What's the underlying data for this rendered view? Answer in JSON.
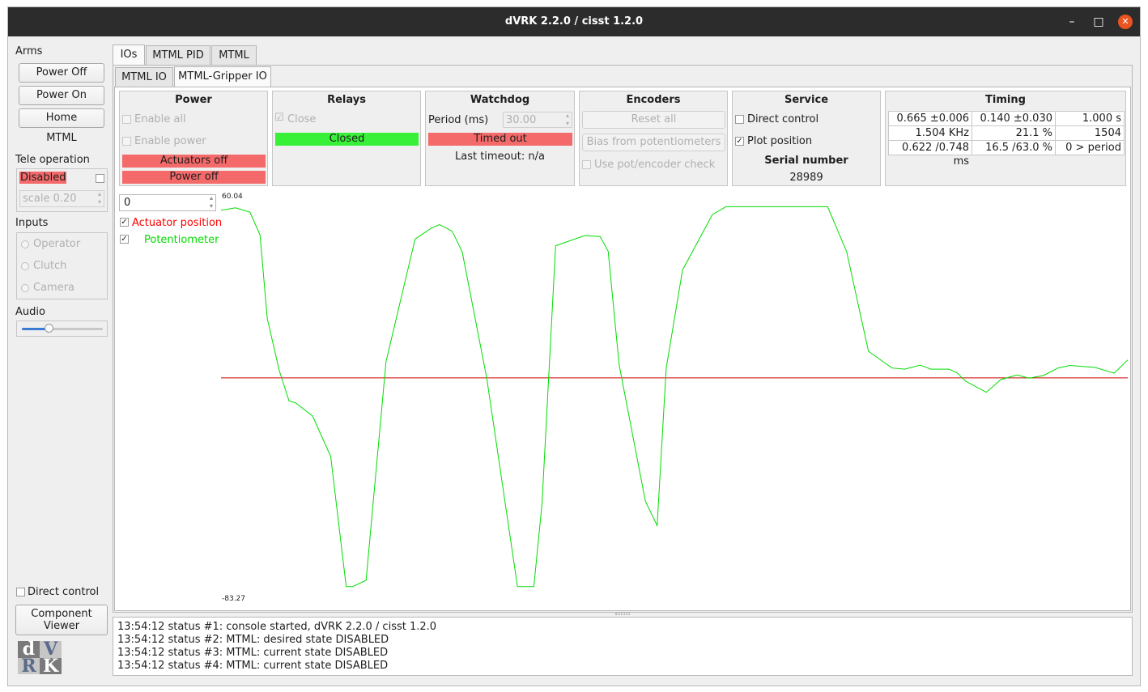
{
  "window": {
    "title": "dVRK 2.2.0 / cisst 1.2.0",
    "min_glyph": "–",
    "max_glyph": "□",
    "close_glyph": "✕"
  },
  "left": {
    "arms_label": "Arms",
    "power_off": "Power Off",
    "power_on": "Power On",
    "home": "Home",
    "arm_name": "MTML",
    "teleop_label": "Tele operation",
    "teleop_state": "Disabled",
    "scale": "scale 0.20",
    "inputs_label": "Inputs",
    "inputs": [
      "Operator",
      "Clutch",
      "Camera"
    ],
    "audio_label": "Audio",
    "audio_level": 0.33,
    "direct_control": "Direct control",
    "component_viewer_1": "Component",
    "component_viewer_2": "Viewer",
    "logo_letters": [
      "d",
      "V",
      "R",
      "K"
    ]
  },
  "tabs": {
    "top": [
      "IOs",
      "MTML PID",
      "MTML"
    ],
    "sub": [
      "MTML IO",
      "MTML-Gripper IO"
    ]
  },
  "power": {
    "title": "Power",
    "enable_all": "Enable all",
    "enable_power": "Enable power",
    "actuators": "Actuators off",
    "power_state": "Power off"
  },
  "relays": {
    "title": "Relays",
    "close": "Close",
    "state": "Closed",
    "close_check": "☑"
  },
  "watchdog": {
    "title": "Watchdog",
    "period_label": "Period (ms)",
    "period_value": "30.00",
    "state": "Timed out",
    "last_timeout": "Last timeout: n/a"
  },
  "encoders": {
    "title": "Encoders",
    "reset_all": "Reset all",
    "bias": "Bias from potentiometers",
    "use_pot": "Use pot/encoder check"
  },
  "service": {
    "title": "Service",
    "direct_control": "Direct control",
    "plot_position": "Plot position",
    "serial_label": "Serial number",
    "serial_value": "28989",
    "check": "✓"
  },
  "timing": {
    "title": "Timing",
    "rows": [
      [
        "0.665 ±0.006 ms",
        "0.140 ±0.030 ms",
        "1.000 s"
      ],
      [
        "1.504  KHz",
        "21.1 %",
        "1504 samples"
      ],
      [
        "0.622 /0.748 ms",
        "16.5 /63.0 %",
        "0 > period"
      ]
    ]
  },
  "plot": {
    "index_value": "0",
    "legend": [
      {
        "label": "Actuator position",
        "color": "#ff0000",
        "check": "✓"
      },
      {
        "label": "Potentiometer",
        "color": "#00dd00",
        "check": "✓"
      }
    ],
    "ymax_label": "60.04",
    "ymin_label": "-83.27"
  },
  "chart_data": {
    "type": "line",
    "ylim": [
      -83.27,
      60.04
    ],
    "series": [
      {
        "name": "Actuator position",
        "color": "#cc0000",
        "x": [
          0,
          100
        ],
        "y": [
          -4.3,
          -4.3
        ]
      },
      {
        "name": "Potentiometer",
        "color": "#00dd00",
        "x": [
          0,
          1.6,
          3.2,
          4.3,
          5.1,
          6.4,
          7.5,
          8.2,
          10.1,
          12.1,
          13.8,
          14.5,
          16.0,
          18.2,
          21.4,
          23.2,
          24.1,
          25.5,
          26.6,
          29.3,
          32.7,
          34.5,
          35.4,
          36.9,
          40.1,
          41.8,
          42.7,
          43.9,
          46.8,
          48.1,
          49.1,
          50.9,
          54.2,
          55.7,
          59.8,
          63.0,
          66.9,
          69.0,
          71.4,
          74.0,
          75.4,
          77.1,
          78.3,
          80.3,
          81.2,
          82.1,
          84.4,
          86.0,
          87.8,
          89.1,
          90.7,
          92.3,
          93.6,
          96.4,
          98.5,
          100
        ],
        "y": [
          53.7,
          54.5,
          53.0,
          45.1,
          16.3,
          -1.5,
          -12.3,
          -12.9,
          -17.5,
          -31.5,
          -76.5,
          -76.5,
          -74.3,
          1.3,
          43.7,
          47.5,
          48.7,
          46.4,
          39.3,
          -4.3,
          -76.5,
          -76.5,
          -47.8,
          41.4,
          44.9,
          44.6,
          39.5,
          0.3,
          -47.0,
          -55.4,
          -0.9,
          33.0,
          52.2,
          54.9,
          54.9,
          54.9,
          54.9,
          39.3,
          4.9,
          -0.9,
          -1.3,
          0.1,
          -1.3,
          -1.3,
          -2.6,
          -5.4,
          -9.3,
          -4.9,
          -3.3,
          -4.4,
          -3.5,
          -0.9,
          0.0,
          -0.7,
          -2.7,
          1.9
        ]
      }
    ]
  },
  "log": [
    "13:54:12 status #1: console started, dVRK 2.2.0 / cisst 1.2.0",
    "13:54:12 status #2: MTML: desired state DISABLED",
    "13:54:12 status #3: MTML: current state DISABLED",
    "13:54:12 status #4: MTML: current state DISABLED"
  ]
}
